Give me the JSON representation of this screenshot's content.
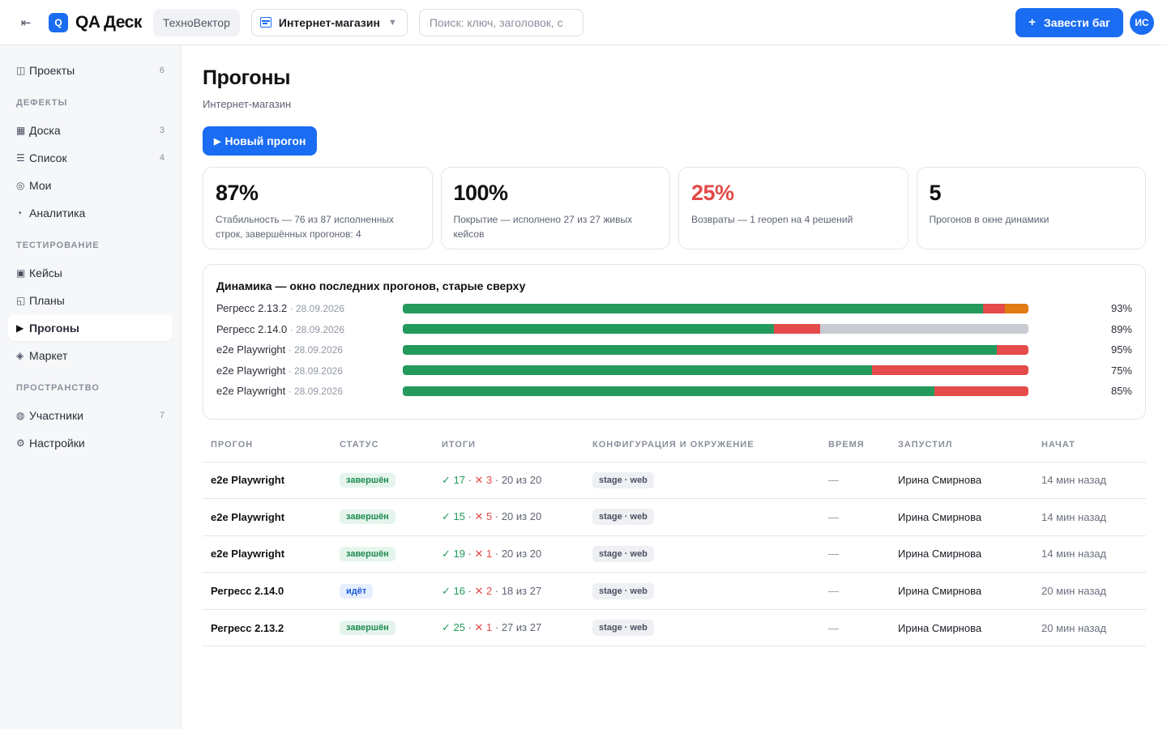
{
  "topbar": {
    "collapse_icon": "⇤",
    "logo_letter": "Q",
    "app_name": "QA Деск",
    "org_name": "ТехноВектор",
    "project_name": "Интернет-магазин",
    "chevron": "▼",
    "search_placeholder": "Поиск: ключ, заголовок, с",
    "report_plus": "+",
    "report_label": "Завести баг",
    "avatar_initials": "ИС"
  },
  "sidebar": {
    "projects": {
      "icon": "◫",
      "label": "Проекты",
      "count": "6"
    },
    "sections": {
      "defects": "ДЕФЕКТЫ",
      "testing": "ТЕСТИРОВАНИЕ",
      "space": "ПРОСТРАНСТВО"
    },
    "defects": [
      {
        "icon": "▦",
        "label": "Доска",
        "count": "3"
      },
      {
        "icon": "☰",
        "label": "Список",
        "count": "4"
      },
      {
        "icon": "◎",
        "label": "Мои",
        "count": ""
      },
      {
        "icon": "◔",
        "label": "Аналитика",
        "count": ""
      }
    ],
    "testing": [
      {
        "icon": "▣",
        "label": "Кейсы",
        "count": ""
      },
      {
        "icon": "◱",
        "label": "Планы",
        "count": ""
      },
      {
        "icon": "▶",
        "label": "Прогоны",
        "count": ""
      },
      {
        "icon": "◈",
        "label": "Маркет",
        "count": ""
      }
    ],
    "space": [
      {
        "icon": "◍",
        "label": "Участники",
        "count": "7"
      },
      {
        "icon": "⚙",
        "label": "Настройки",
        "count": ""
      }
    ]
  },
  "page": {
    "title": "Прогоны",
    "subtitle": "Интернет-магазин",
    "new_run_icon": "▶",
    "new_run_label": "Новый прогон"
  },
  "kpis": [
    {
      "value": "87%",
      "desc": "Стабильность — 76 из 87 исполненных строк, завершённых прогонов: 4",
      "color": "#111111"
    },
    {
      "value": "100%",
      "desc": "Покрытие — исполнено 27 из 27 живых кейсов",
      "color": "#111111"
    },
    {
      "value": "25%",
      "desc": "Возвраты — 1 reopen на 4 решений",
      "color": "#e24a48"
    },
    {
      "value": "5",
      "desc": "Прогонов в окне динамики",
      "color": "#111111"
    }
  ],
  "dynamics": {
    "title": "Динамика — окно последних прогонов, старые сверху",
    "rows": [
      {
        "name": "Регресс 2.13.2",
        "date": " · 28.09.2026",
        "pass": 0.927,
        "fail": 0.036,
        "blocked": 0.037,
        "untested": 0,
        "pct": "93%"
      },
      {
        "name": "Регресс 2.14.0",
        "date": " · 28.09.2026",
        "pass": 0.593,
        "fail": 0.074,
        "blocked": 0,
        "untested": 0.333,
        "pct": "89%"
      },
      {
        "name": "e2e Playwright",
        "date": " · 28.09.2026",
        "pass": 0.95,
        "fail": 0.05,
        "blocked": 0,
        "untested": 0,
        "pct": "95%"
      },
      {
        "name": "e2e Playwright",
        "date": " · 28.09.2026",
        "pass": 0.75,
        "fail": 0.25,
        "blocked": 0,
        "untested": 0,
        "pct": "75%"
      },
      {
        "name": "e2e Playwright",
        "date": " · 28.09.2026",
        "pass": 0.85,
        "fail": 0.15,
        "blocked": 0,
        "untested": 0,
        "pct": "85%"
      }
    ],
    "colors": {
      "pass": "#239a5b",
      "fail": "#e54b4b",
      "blocked": "#e07b12",
      "untested": "#c9cbd2"
    }
  },
  "table": {
    "headers": [
      "ПРОГОН",
      "СТАТУС",
      "ИТОГИ",
      "КОНФИГУРАЦИЯ И ОКРУЖЕНИЕ",
      "ВРЕМЯ",
      "ЗАПУСТИЛ",
      "НАЧАТ"
    ],
    "rows": [
      {
        "name": "e2e Playwright",
        "status": "завершён",
        "status_kind": "done",
        "passed": "✓ 17",
        "failed": "✕ 3",
        "total": " · 20 из 20",
        "env": "stage · web",
        "time": "—",
        "launcher": "Ирина Смирнова",
        "started": "14 мин назад"
      },
      {
        "name": "e2e Playwright",
        "status": "завершён",
        "status_kind": "done",
        "passed": "✓ 15",
        "failed": "✕ 5",
        "total": " · 20 из 20",
        "env": "stage · web",
        "time": "—",
        "launcher": "Ирина Смирнова",
        "started": "14 мин назад"
      },
      {
        "name": "e2e Playwright",
        "status": "завершён",
        "status_kind": "done",
        "passed": "✓ 19",
        "failed": "✕ 1",
        "total": " · 20 из 20",
        "env": "stage · web",
        "time": "—",
        "launcher": "Ирина Смирнова",
        "started": "14 мин назад"
      },
      {
        "name": "Регресс 2.14.0",
        "status": "идёт",
        "status_kind": "running",
        "passed": "✓ 16",
        "failed": "✕ 2",
        "total": " · 18 из 27",
        "env": "stage · web",
        "time": "—",
        "launcher": "Ирина Смирнова",
        "started": "20 мин назад"
      },
      {
        "name": "Регресс 2.13.2",
        "status": "завершён",
        "status_kind": "done",
        "passed": "✓ 25",
        "failed": "✕ 1",
        "total": " · 27 из 27",
        "env": "stage · web",
        "time": "—",
        "launcher": "Ирина Смирнова",
        "started": "20 мин назад"
      }
    ]
  }
}
